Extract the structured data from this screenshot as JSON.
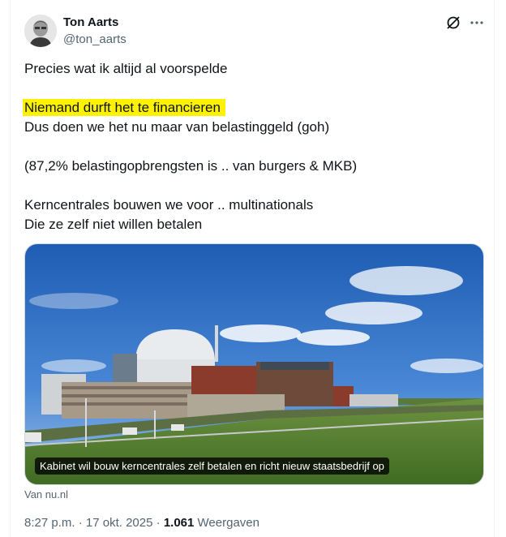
{
  "author": {
    "name": "Ton Aarts",
    "handle": "@ton_aarts",
    "avatar_icon": "avatar-photo"
  },
  "header_icons": [
    "grok-icon",
    "more-icon"
  ],
  "tweet": {
    "lines": [
      "Precies wat ik altijd al voorspelde",
      "",
      "Niemand durft het te financieren",
      "Dus doen we het nu maar van belastinggeld (goh)",
      "",
      "(87,2% belastingopbrengsten is .. van burgers & MKB)",
      "",
      "Kerncentrales bouwen we voor .. multinationals",
      "Die ze zelf niet willen betalen"
    ],
    "highlight_color": "#fff200"
  },
  "media": {
    "caption": "Kabinet wil bouw kerncentrales zelf betalen en richt nieuw staatsbedrijf op",
    "source": "Van nu.nl",
    "sky_color": "#2f6fc4",
    "grass_color": "#4f7a2a"
  },
  "meta": {
    "time": "8:27 p.m.",
    "separator": " · ",
    "date": "17 okt. 2025",
    "views_count": "1.061",
    "views_label": "Weergaven"
  }
}
